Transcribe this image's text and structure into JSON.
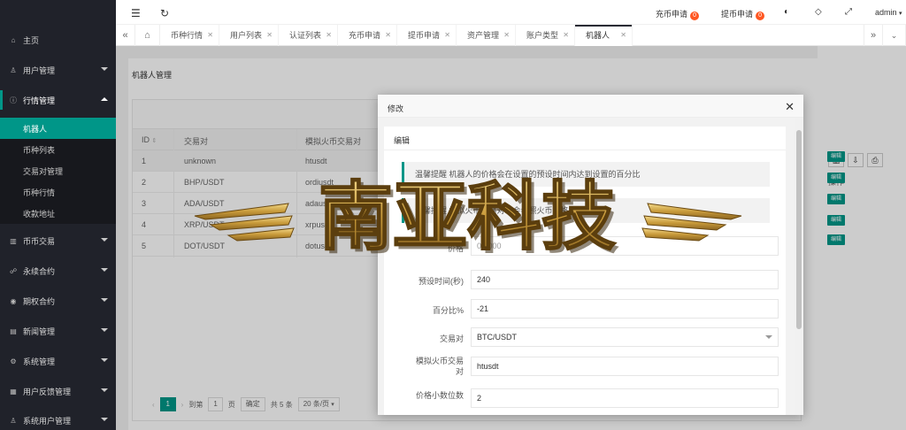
{
  "sidebar": {
    "items": [
      {
        "label": "主页",
        "icon": "home-icon"
      },
      {
        "label": "用户管理",
        "icon": "user-icon"
      },
      {
        "label": "行情管理",
        "icon": "info-icon"
      },
      {
        "label": "币币交易",
        "icon": "exchange-icon"
      },
      {
        "label": "永续合约",
        "icon": "contract-icon"
      },
      {
        "label": "期权合约",
        "icon": "option-icon"
      },
      {
        "label": "新闻管理",
        "icon": "news-icon"
      },
      {
        "label": "系统管理",
        "icon": "settings-icon"
      },
      {
        "label": "用户反馈管理",
        "icon": "feedback-icon"
      },
      {
        "label": "系统用户管理",
        "icon": "admin-user-icon"
      }
    ],
    "sub_items": [
      "机器人",
      "币种列表",
      "交易对管理",
      "币种行情",
      "收款地址"
    ]
  },
  "header": {
    "deposit_label": "充币申请",
    "deposit_count": "0",
    "withdraw_label": "提币申请",
    "withdraw_count": "0",
    "user": "admin"
  },
  "tabs": [
    "币种行情",
    "用户列表",
    "认证列表",
    "充币申请",
    "提币申请",
    "资产管理",
    "账户类型",
    "机器人"
  ],
  "page": {
    "title": "机器人管理",
    "columns": [
      "ID",
      "交易对",
      "模拟火币交易对",
      "操作"
    ],
    "rows": [
      {
        "id": "1",
        "pair": "unknown",
        "sim": "htusdt"
      },
      {
        "id": "2",
        "pair": "BHP/USDT",
        "sim": "ordiusdt"
      },
      {
        "id": "3",
        "pair": "ADA/USDT",
        "sim": "adausdt"
      },
      {
        "id": "4",
        "pair": "XRP/USDT",
        "sim": "xrpusdt"
      },
      {
        "id": "5",
        "pair": "DOT/USDT",
        "sim": "dotusdt"
      }
    ],
    "edit_label": "编辑",
    "pager": {
      "current": "1",
      "goto_label": "到第",
      "goto_value": "1",
      "page_unit": "页",
      "confirm": "确定",
      "total": "共 5 条",
      "per_page": "20 条/页"
    }
  },
  "modal": {
    "title": "修改",
    "card_title": "编辑",
    "hint1": "温馨提醒 机器人的价格会在设置的预设时间内达到设置的百分比",
    "hint2": "温馨提醒 模拟火币交易对时会参照火币价格模拟走势",
    "fields": [
      {
        "label": "价格",
        "value": "0.0000"
      },
      {
        "label": "预设时间(秒)",
        "value": "240"
      },
      {
        "label": "百分比%",
        "value": "-21"
      },
      {
        "label": "交易对",
        "value": "BTC/USDT"
      },
      {
        "label": "模拟火币交易对",
        "value": "htusdt"
      },
      {
        "label": "价格小数位数",
        "value": "2"
      }
    ]
  },
  "watermark": {
    "text": "南亚科技"
  }
}
